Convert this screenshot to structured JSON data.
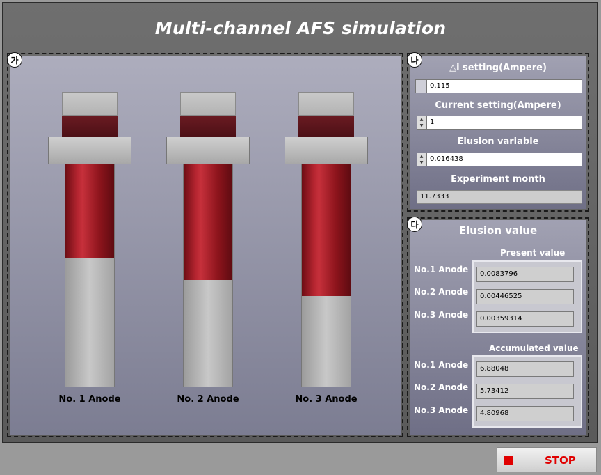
{
  "window": {
    "title": "Multi-channel AFS simulation"
  },
  "colors": {
    "fill": "#b52530",
    "background": "#6f6f6f",
    "stop": "#e00000"
  },
  "panel_a": {
    "badge": "가",
    "anodes": [
      {
        "label": "No. 1 Anode",
        "fill_fraction": 0.42
      },
      {
        "label": "No. 2 Anode",
        "fill_fraction": 0.52
      },
      {
        "label": "No. 3 Anode",
        "fill_fraction": 0.59
      }
    ]
  },
  "panel_b": {
    "badge": "나",
    "delta_label": "△i setting(Ampere)",
    "delta_value": "0.115",
    "current_label": "Current setting(Ampere)",
    "current_value": "1",
    "elusion_label": "Elusion variable",
    "elusion_value": "0.016438",
    "month_label": "Experiment month",
    "month_value": "11.7333"
  },
  "panel_c": {
    "badge": "다",
    "title": "Elusion value",
    "present_label": "Present value",
    "accumulated_label": "Accumulated value",
    "rows": [
      "No.1 Anode",
      "No.2 Anode",
      "No.3 Anode"
    ],
    "present": [
      "0.0083796",
      "0.00446525",
      "0.00359314"
    ],
    "accumulated": [
      "6.88048",
      "5.73412",
      "4.80968"
    ]
  },
  "stop": {
    "label": "STOP"
  }
}
